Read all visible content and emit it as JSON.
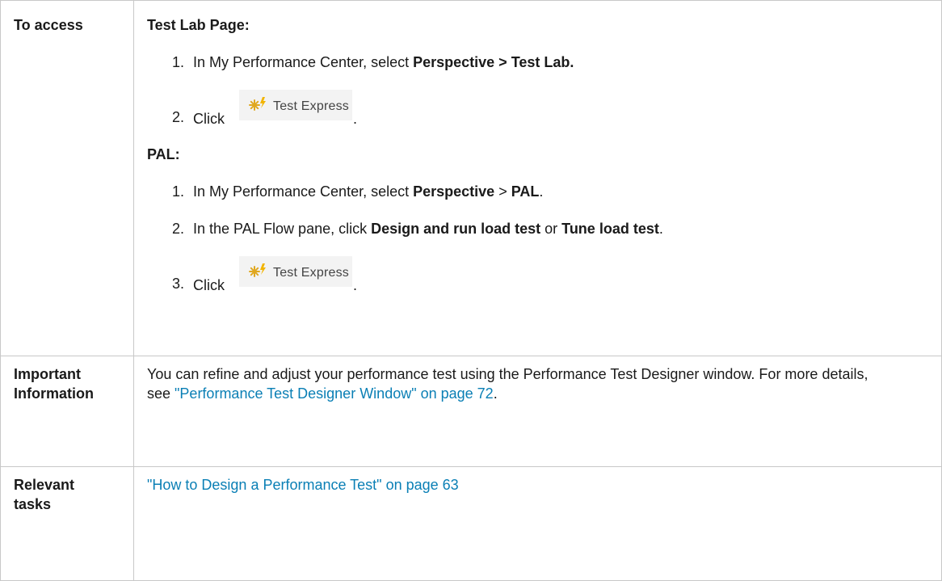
{
  "rows": {
    "access": {
      "heading": "To access",
      "test_lab": {
        "title": "Test Lab Page:",
        "step1": {
          "num": "1.",
          "prefix": "In My Performance Center, select ",
          "bold": "Perspective > Test Lab."
        },
        "step2": {
          "num": "2.",
          "prefix": "Click",
          "button_label": "Test Express",
          "suffix": "."
        }
      },
      "pal": {
        "title": "PAL:",
        "step1": {
          "num": "1.",
          "prefix": "In My Performance Center, select ",
          "bold1": "Perspective",
          "mid": " > ",
          "bold2": "PAL",
          "suffix": "."
        },
        "step2": {
          "num": "2.",
          "prefix": "In the PAL Flow pane, click ",
          "bold1": "Design and run load test",
          "mid": " or ",
          "bold2": "Tune load test",
          "suffix": "."
        },
        "step3": {
          "num": "3.",
          "prefix": "Click",
          "button_label": "Test Express",
          "suffix": "."
        }
      }
    },
    "important": {
      "heading_line1": "Important",
      "heading_line2": "Information",
      "text": "You can refine and adjust your performance test using the Performance Test Designer window. For more details, see ",
      "link_text": "\"Performance Test Designer Window\" on page 72",
      "suffix": "."
    },
    "tasks": {
      "heading_line1": "Relevant",
      "heading_line2": "tasks",
      "link_text": "\"How to Design a Performance Test\" on page 63"
    }
  },
  "icon": {
    "name": "test-express-icon",
    "color": "#e0a820"
  }
}
